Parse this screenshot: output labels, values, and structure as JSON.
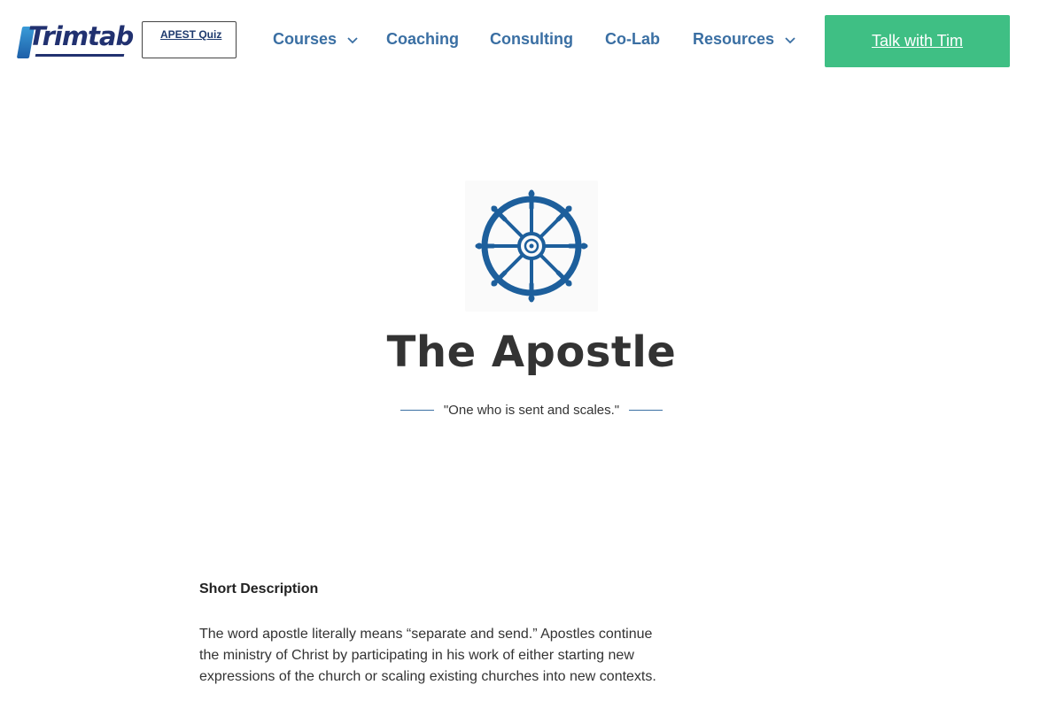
{
  "header": {
    "logo_text": "Trimtab",
    "quiz_button": "APEST Quiz",
    "nav": [
      {
        "label": "Courses",
        "dropdown": true
      },
      {
        "label": "Coaching",
        "dropdown": false
      },
      {
        "label": "Consulting",
        "dropdown": false
      },
      {
        "label": "Co-Lab",
        "dropdown": false
      },
      {
        "label": "Resources",
        "dropdown": true
      }
    ],
    "cta_label": "Talk with Tim"
  },
  "hero": {
    "icon": "ship-wheel-icon",
    "title": "The Apostle",
    "tagline": "\"One who is sent and scales.\""
  },
  "section": {
    "heading": "Short Description",
    "body": "The word apostle literally means “separate and send.” Apostles continue the ministry of Christ by participating in his work of either starting new expressions of the church or scaling existing churches into new contexts."
  },
  "colors": {
    "nav_text": "#3a6fa3",
    "cta_bg": "#3fbf84",
    "wheel": "#1d5f9c",
    "logo_text": "#213170"
  }
}
